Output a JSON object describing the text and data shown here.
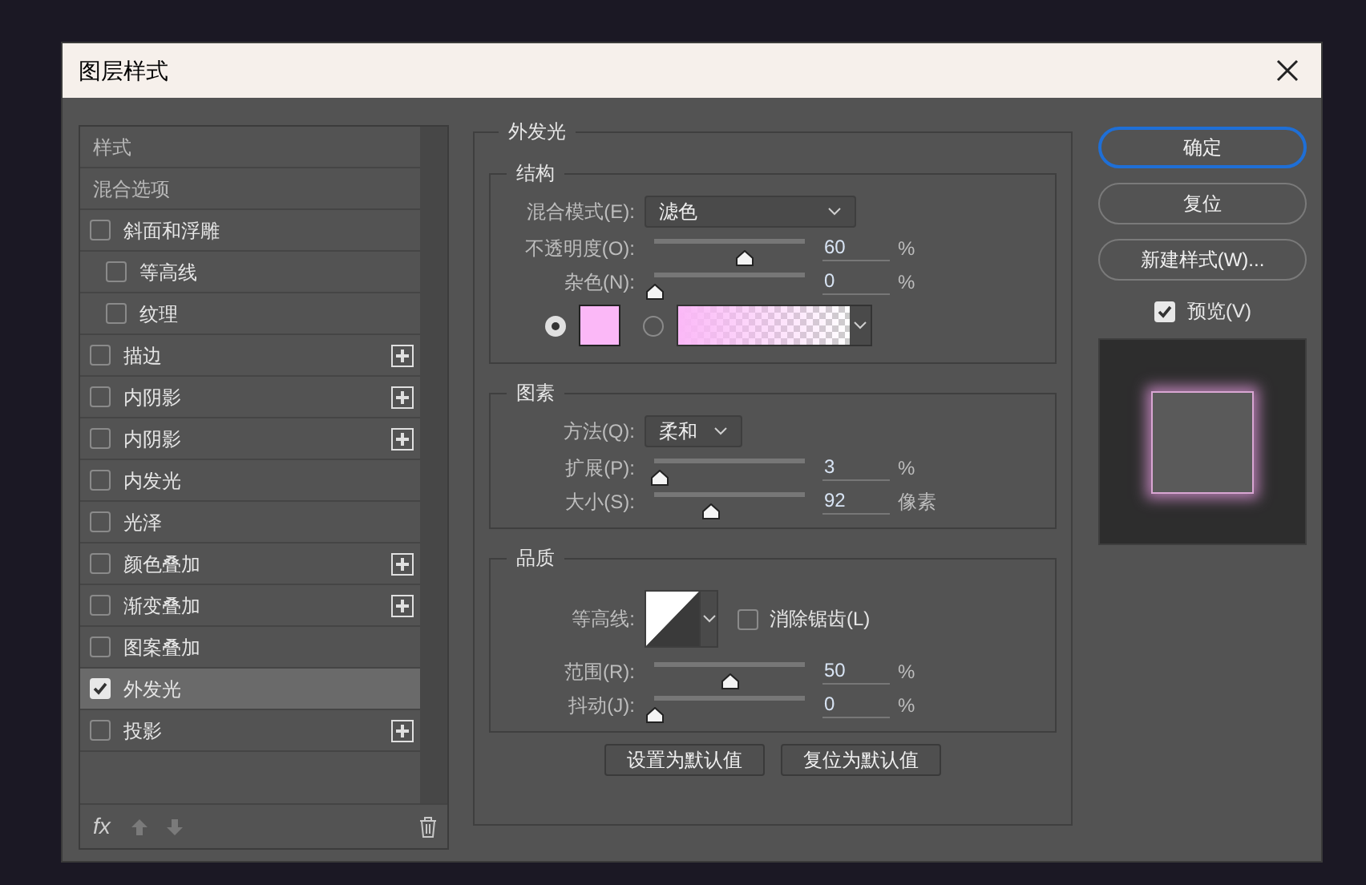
{
  "window": {
    "title": "图层样式"
  },
  "styles_list": {
    "items": [
      {
        "kind": "header",
        "label": "样式",
        "selected": false
      },
      {
        "kind": "header",
        "label": "混合选项",
        "selected": false
      },
      {
        "kind": "effect",
        "label": "斜面和浮雕",
        "checked": false,
        "addable": false,
        "selected": false,
        "children": [
          {
            "kind": "effect",
            "label": "等高线",
            "checked": false,
            "addable": false,
            "selected": false
          },
          {
            "kind": "effect",
            "label": "纹理",
            "checked": false,
            "addable": false,
            "selected": false
          }
        ]
      },
      {
        "kind": "effect",
        "label": "描边",
        "checked": false,
        "addable": true,
        "selected": false
      },
      {
        "kind": "effect",
        "label": "内阴影",
        "checked": false,
        "addable": true,
        "selected": false
      },
      {
        "kind": "effect",
        "label": "内阴影",
        "checked": false,
        "addable": true,
        "selected": false
      },
      {
        "kind": "effect",
        "label": "内发光",
        "checked": false,
        "addable": false,
        "selected": false
      },
      {
        "kind": "effect",
        "label": "光泽",
        "checked": false,
        "addable": false,
        "selected": false
      },
      {
        "kind": "effect",
        "label": "颜色叠加",
        "checked": false,
        "addable": true,
        "selected": false
      },
      {
        "kind": "effect",
        "label": "渐变叠加",
        "checked": false,
        "addable": true,
        "selected": false
      },
      {
        "kind": "effect",
        "label": "图案叠加",
        "checked": false,
        "addable": false,
        "selected": false
      },
      {
        "kind": "effect",
        "label": "外发光",
        "checked": true,
        "addable": false,
        "selected": true
      },
      {
        "kind": "effect",
        "label": "投影",
        "checked": false,
        "addable": true,
        "selected": false
      }
    ],
    "footer": {
      "fx_label": "fx"
    }
  },
  "panel": {
    "title": "外发光",
    "groups": [
      {
        "title": "结构",
        "rows": [
          {
            "kind": "select",
            "label": "混合模式(E):",
            "value": "滤色"
          },
          {
            "kind": "slider",
            "label": "不透明度(O):",
            "level": 0.6,
            "value": "60",
            "unit": "%"
          },
          {
            "kind": "slider",
            "label": "杂色(N):",
            "level": 0,
            "value": "0",
            "unit": "%"
          },
          {
            "kind": "color_source",
            "options": [
              {
                "kind": "solid",
                "selected": true,
                "color": "#fbb8f7"
              },
              {
                "kind": "gradient",
                "selected": false,
                "color": "#fbb8f7"
              }
            ]
          }
        ]
      },
      {
        "title": "图素",
        "rows": [
          {
            "kind": "select",
            "label": "方法(Q):",
            "value": "柔和"
          },
          {
            "kind": "slider",
            "label": "扩展(P):",
            "level": 0.03,
            "value": "3",
            "unit": "%"
          },
          {
            "kind": "slider",
            "label": "大小(S):",
            "level": 0.37,
            "value": "92",
            "unit": "像素"
          }
        ]
      },
      {
        "title": "品质",
        "rows": [
          {
            "kind": "contour",
            "label": "等高线:",
            "checkbox_label": "消除锯齿(L)",
            "checked": false
          },
          {
            "kind": "slider",
            "label": "范围(R):",
            "level": 0.5,
            "value": "50",
            "unit": "%"
          },
          {
            "kind": "slider",
            "label": "抖动(J):",
            "level": 0,
            "value": "0",
            "unit": "%"
          }
        ]
      }
    ],
    "buttons": [
      "设置为默认值",
      "复位为默认值"
    ]
  },
  "actions": [
    {
      "label": "确定",
      "default": true
    },
    {
      "label": "复位",
      "default": false
    },
    {
      "label": "新建样式(W)...",
      "default": false
    }
  ],
  "preview": {
    "label": "预览(V)",
    "checked": true
  }
}
